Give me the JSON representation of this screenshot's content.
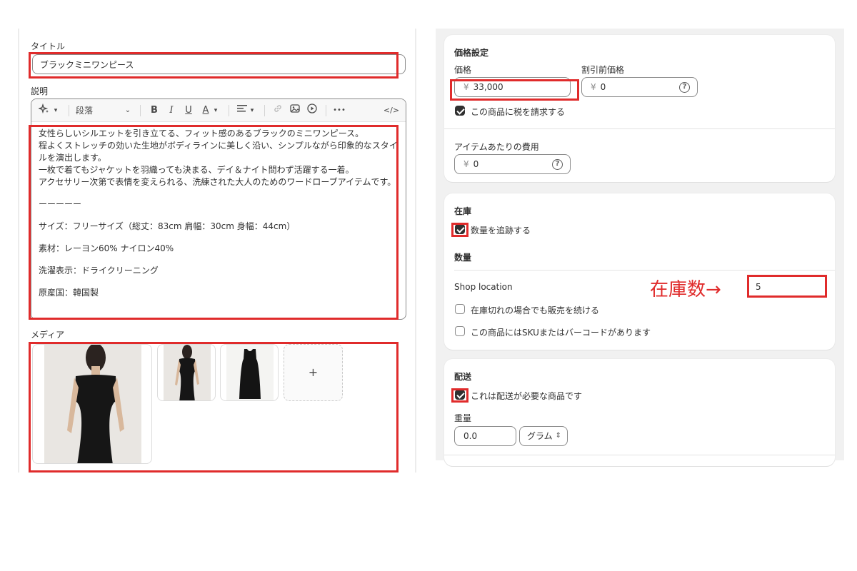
{
  "product": {
    "title_label": "タイトル",
    "title_value": "ブラックミニワンピース",
    "description_label": "説明",
    "toolbar": {
      "paragraph": "段落",
      "bold": "B",
      "italic": "I",
      "underline": "U",
      "text_color": "A",
      "more": "•••",
      "code": "</>"
    },
    "description_lines": [
      "女性らしいシルエットを引き立てる、フィット感のあるブラックのミニワンピース。",
      "程よくストレッチの効いた生地がボディラインに美しく沿い、シンプルながら印象的なスタイルを演出します。",
      "一枚で着てもジャケットを羽織っても決まる、デイ＆ナイト問わず活躍する一着。",
      "アクセサリー次第で表情を変えられる、洗練された大人のためのワードローブアイテムです。",
      "ーーーーー",
      "サイズ：フリーサイズ（総丈：83cm 肩幅：30cm 身幅：44cm）",
      "素材：レーヨン60% ナイロン40%",
      "洗濯表示：ドライクリーニング",
      "原産国：韓国製"
    ],
    "media_label": "メディア",
    "media_add": "+"
  },
  "pricing": {
    "title": "価格設定",
    "price_label": "価格",
    "price_currency": "¥",
    "price_value": "33,000",
    "compare_label": "割引前価格",
    "compare_currency": "¥",
    "compare_value": "0",
    "charge_tax_label": "この商品に税を請求する",
    "cost_label": "アイテムあたりの費用",
    "cost_currency": "¥",
    "cost_value": "0"
  },
  "inventory": {
    "title": "在庫",
    "track_label": "数量を追跡する",
    "quantity_heading": "数量",
    "location": "Shop location",
    "quantity_value": "5",
    "continue_selling_label": "在庫切れの場合でも販売を続ける",
    "sku_label": "この商品にはSKUまたはバーコードがあります",
    "annotation": "在庫数→"
  },
  "shipping": {
    "title": "配送",
    "physical_label": "これは配送が必要な商品です",
    "weight_label": "重量",
    "weight_value": "0.0",
    "weight_unit": "グラム"
  },
  "colors": {
    "annotation_red": "#e02b2b",
    "checkbox_dark": "#303030",
    "panel_bg": "#f1f1f1"
  }
}
